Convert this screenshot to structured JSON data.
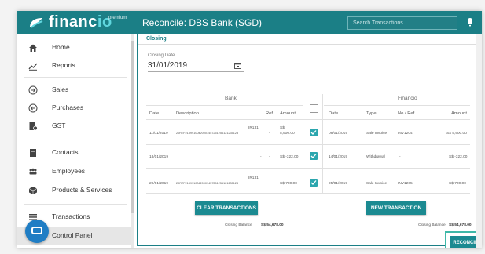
{
  "brand": {
    "name_a": "financ",
    "name_b": "io",
    "tag": "premium"
  },
  "header": {
    "title": "Reconcile: DBS Bank (SGD)",
    "search_placeholder": "Search Transactions"
  },
  "sidebar": {
    "items": [
      {
        "label": "Home",
        "icon": "home-icon"
      },
      {
        "label": "Reports",
        "icon": "chart-line-icon"
      },
      {
        "label": "Sales",
        "icon": "sales-icon"
      },
      {
        "label": "Purchases",
        "icon": "purchases-icon"
      },
      {
        "label": "GST",
        "icon": "gst-icon"
      },
      {
        "label": "Contacts",
        "icon": "contacts-icon"
      },
      {
        "label": "Employees",
        "icon": "employees-icon"
      },
      {
        "label": "Products & Services",
        "icon": "box-icon"
      },
      {
        "label": "Transactions",
        "icon": "transactions-icon"
      },
      {
        "label": "Control Panel",
        "icon": "control-panel-icon"
      }
    ]
  },
  "main": {
    "tab": "Closing",
    "closing_date_label": "Closing Date",
    "closing_date": "31/01/2019",
    "bank": {
      "heading": "Bank",
      "columns": [
        "Date",
        "Description",
        "Ref",
        "Amount"
      ],
      "rows": [
        {
          "date": "11/01/2019",
          "desc_top": "IR131",
          "desc_bottom": "20RTF21899100420001457251256121235123",
          "ref": "-",
          "amount_top": "S$",
          "amount_bottom": "5,900.00",
          "checked": true
        },
        {
          "date": "18/01/2019",
          "desc_top": "",
          "desc_bottom": "-",
          "ref": "-",
          "amount_top": "",
          "amount_bottom": "S$ -322.00",
          "checked": true
        },
        {
          "date": "29/01/2019",
          "desc_top": "IR131",
          "desc_bottom": "20RTF21899100420001457251256121235123",
          "ref": "-",
          "amount_top": "",
          "amount_bottom": "S$ 700.00",
          "checked": true
        }
      ]
    },
    "financio": {
      "heading": "Financio",
      "columns": [
        "Date",
        "Type",
        "No / Ref",
        "Amount"
      ],
      "rows": [
        {
          "date": "08/01/2019",
          "type": "Sale Invoice",
          "ref": "INV1204",
          "amount": "S$ 5,900.00"
        },
        {
          "date": "14/01/2019",
          "type": "Withdrawal",
          "ref": "-",
          "amount": "S$ -322.00"
        },
        {
          "date": "25/01/2019",
          "type": "Sale Invoice",
          "ref": "INV1205",
          "amount": "S$ 700.00"
        }
      ]
    },
    "clear_label": "CLEAR TRANSACTIONS",
    "new_label": "NEW TRANSACTION",
    "bank_balance_label": "Closing Balance",
    "bank_balance": "S$ 54,678.00",
    "fin_balance_label": "Closing Balance",
    "fin_balance": "S$ 54,678.00",
    "reconcile_label": "RECONCILE"
  }
}
